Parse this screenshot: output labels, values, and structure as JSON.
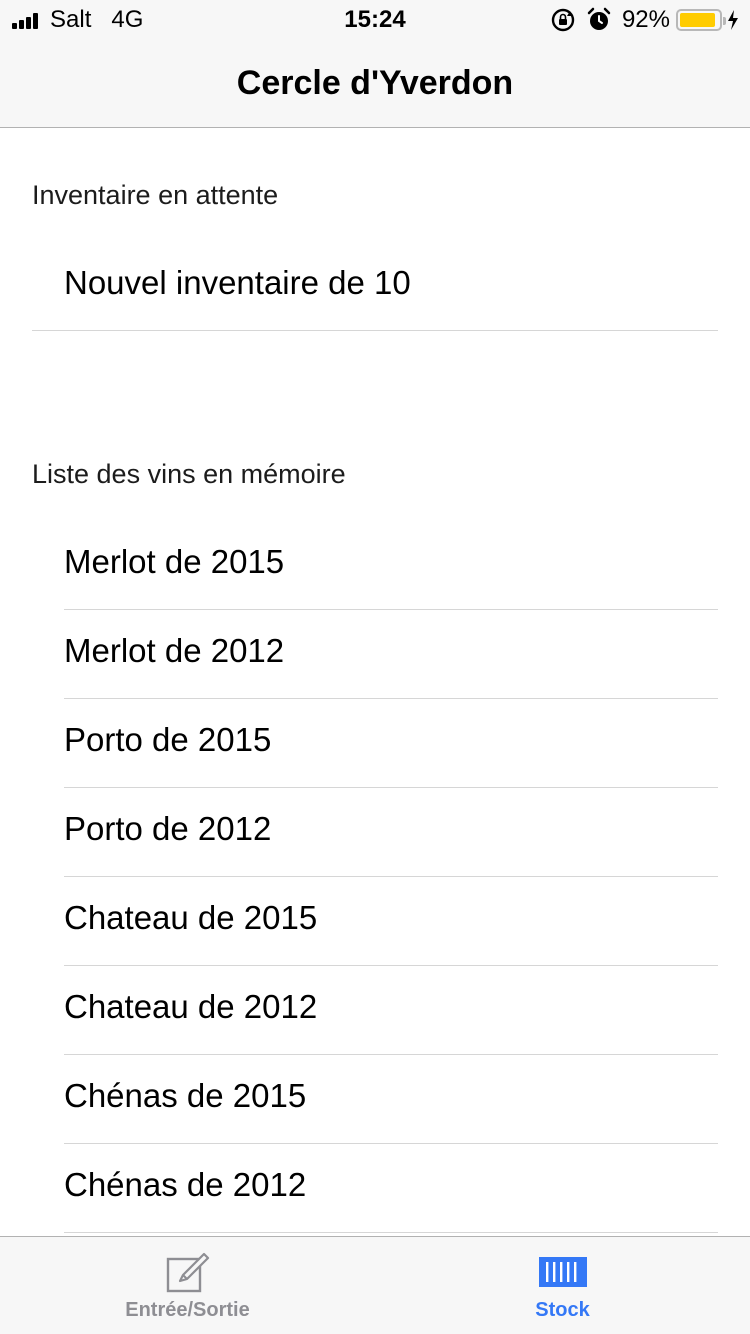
{
  "status_bar": {
    "carrier": "Salt",
    "network": "4G",
    "time": "15:24",
    "battery_percent_label": "92%",
    "battery_level": 0.92,
    "battery_color": "#ffcc00"
  },
  "nav": {
    "title": "Cercle d'Yverdon"
  },
  "pending_section": {
    "header": "Inventaire en attente",
    "items": [
      {
        "label": "Nouvel inventaire de 10"
      }
    ]
  },
  "wines_section": {
    "header": "Liste des vins en mémoire",
    "items": [
      {
        "label": "Merlot de 2015"
      },
      {
        "label": "Merlot de 2012"
      },
      {
        "label": "Porto de 2015"
      },
      {
        "label": "Porto de 2012"
      },
      {
        "label": "Chateau de 2015"
      },
      {
        "label": "Chateau de 2012"
      },
      {
        "label": "Chénas de 2015"
      },
      {
        "label": "Chénas de 2012"
      }
    ]
  },
  "tab_bar": {
    "tabs": [
      {
        "label": "Entrée/Sortie",
        "icon": "edit-icon",
        "active": false
      },
      {
        "label": "Stock",
        "icon": "barcode-icon",
        "active": true
      }
    ],
    "active_color": "#3478f6",
    "inactive_color": "#8e8e93"
  }
}
